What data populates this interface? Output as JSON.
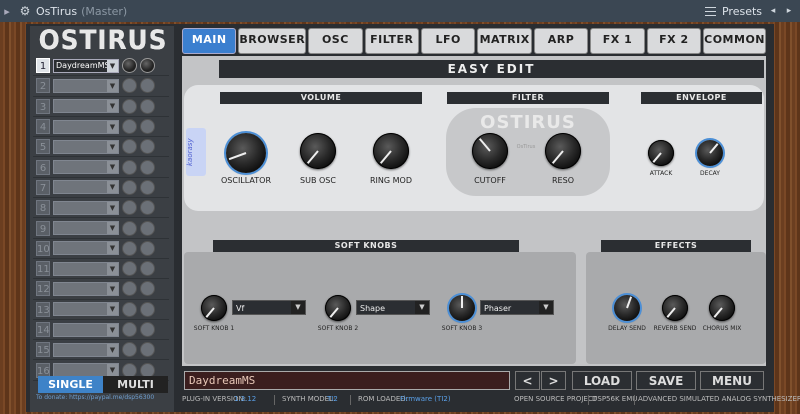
{
  "host": {
    "title": "OsTirus",
    "subtitle": "(Master)",
    "presets_label": "Presets"
  },
  "logo": "OSTIRUS",
  "parts": [
    {
      "num": "1",
      "preset": "DaydreamMS",
      "active": true
    },
    {
      "num": "2",
      "preset": ""
    },
    {
      "num": "3",
      "preset": ""
    },
    {
      "num": "4",
      "preset": ""
    },
    {
      "num": "5",
      "preset": ""
    },
    {
      "num": "6",
      "preset": ""
    },
    {
      "num": "7",
      "preset": ""
    },
    {
      "num": "8",
      "preset": ""
    },
    {
      "num": "9",
      "preset": ""
    },
    {
      "num": "10",
      "preset": ""
    },
    {
      "num": "11",
      "preset": ""
    },
    {
      "num": "12",
      "preset": ""
    },
    {
      "num": "13",
      "preset": ""
    },
    {
      "num": "14",
      "preset": ""
    },
    {
      "num": "15",
      "preset": ""
    },
    {
      "num": "16",
      "preset": ""
    }
  ],
  "mode": {
    "single": "SINGLE",
    "multi": "MULTI"
  },
  "donate": "To donate: https://paypal.me/dsp56300",
  "tabs": [
    "MAIN",
    "BROWSER",
    "OSC",
    "FILTER",
    "LFO",
    "MATRIX",
    "ARP",
    "FX 1",
    "FX 2",
    "COMMON"
  ],
  "easy_edit": "EASY EDIT",
  "sections": {
    "volume": "VOLUME",
    "filter": "FILTER",
    "envelope": "ENVELOPE",
    "soft_knobs": "SOFT KNOBS",
    "effects": "EFFECTS"
  },
  "filter_logo": "OSTIRUS",
  "knobs": {
    "oscillator": "OSCILLATOR",
    "sub_osc": "SUB OSC",
    "ring_mod": "RING MOD",
    "cutoff": "CUTOFF",
    "reso": "RESO",
    "attack": "ATTACK",
    "decay": "DECAY",
    "soft1": "SOFT KNOB 1",
    "soft2": "SOFT KNOB 2",
    "soft3": "SOFT KNOB 3",
    "delay_send": "DELAY SEND",
    "reverb_send": "REVERB SEND",
    "chorus_mix": "CHORUS MIX"
  },
  "soft_selects": {
    "s1": "Vf",
    "s2": "Shape",
    "s3": "Phaser"
  },
  "preset_display": "DaydreamMS",
  "buttons": {
    "prev": "<",
    "next": ">",
    "load": "LOAD",
    "save": "SAVE",
    "menu": "MENU"
  },
  "status": {
    "plugin_label": "PLUG-IN VERSION:",
    "plugin_value": "1.3.12",
    "synth_label": "SYNTH MODEL:",
    "synth_value": "TI2",
    "rom_label": "ROM LOADED:",
    "rom_value": "Firmware (TI2)",
    "open_source": "OPEN SOURCE PROJECT",
    "dsp": "DSP56K EMU",
    "adv": "ADVANCED SIMULATED ANALOG SYNTHESIZER"
  }
}
